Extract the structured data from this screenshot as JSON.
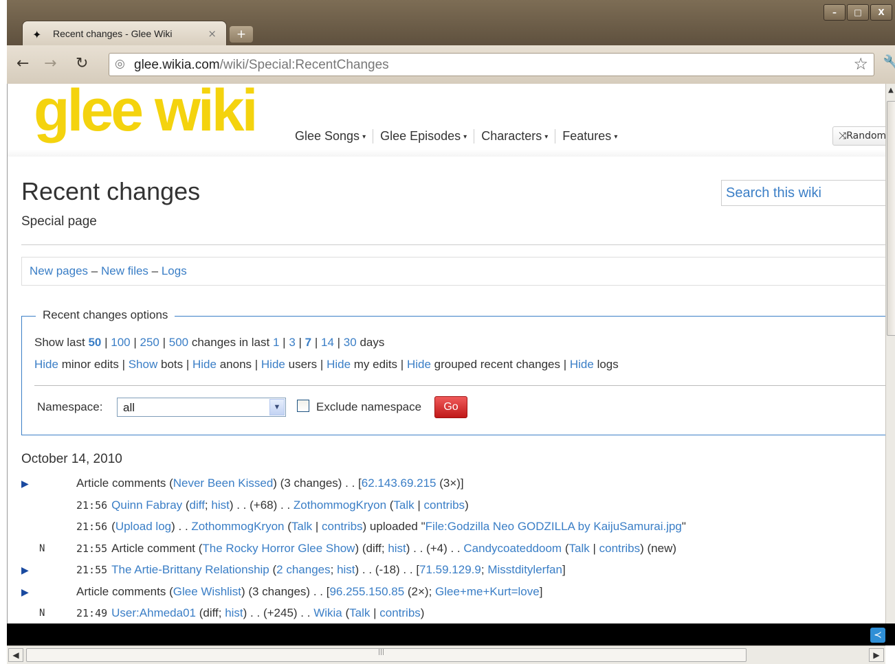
{
  "browser": {
    "tab_title": "Recent changes - Glee Wiki",
    "tab_close": "×",
    "new_tab": "+",
    "url_domain": "glee.wikia.com",
    "url_path": "/wiki/Special:RecentChanges",
    "window_controls": [
      "–",
      "□",
      "X"
    ]
  },
  "site": {
    "logo": "glee wiki",
    "nav": [
      {
        "label": "Glee Songs"
      },
      {
        "label": "Glee Episodes"
      },
      {
        "label": "Characters"
      },
      {
        "label": "Features"
      }
    ],
    "random_button": "Random"
  },
  "header": {
    "title": "Recent changes",
    "subtitle": "Special page",
    "search_placeholder": "Search this wiki"
  },
  "quicklinks": {
    "new_pages": "New pages",
    "sep1": " – ",
    "new_files": "New files",
    "sep2": " – ",
    "logs": "Logs"
  },
  "options": {
    "legend": "Recent changes options",
    "show_last": "Show last ",
    "limits": [
      "50",
      "100",
      "250",
      "500"
    ],
    "changes_in_last": " changes in last ",
    "days_options": [
      "1",
      "3",
      "7",
      "14",
      "30"
    ],
    "days": " days",
    "toggles": [
      {
        "action": "Hide",
        "label": "minor edits"
      },
      {
        "action": "Show",
        "label": "bots"
      },
      {
        "action": "Hide",
        "label": "anons"
      },
      {
        "action": "Hide",
        "label": "users"
      },
      {
        "action": "Hide",
        "label": "my edits"
      },
      {
        "action": "Hide",
        "label": "grouped recent changes"
      },
      {
        "action": "Hide",
        "label": "logs"
      }
    ],
    "namespace_label": "Namespace:",
    "namespace_value": "all",
    "exclude_label": "Exclude namespace",
    "go": "Go"
  },
  "changes": {
    "date": "October 14, 2010",
    "rows": [
      {
        "marker": "▶",
        "flag": "",
        "time": "",
        "parts": [
          {
            "t": "Article comments ("
          },
          {
            "t": "Never Been Kissed",
            "link": true
          },
          {
            "t": ") (3 changes) . . ["
          },
          {
            "t": "62.143.69.215",
            "link": true
          },
          {
            "t": " (3×)]"
          }
        ]
      },
      {
        "marker": "",
        "flag": "",
        "time": "21:56",
        "parts": [
          {
            "t": "Quinn Fabray",
            "link": true
          },
          {
            "t": " ("
          },
          {
            "t": "diff",
            "link": true
          },
          {
            "t": "; "
          },
          {
            "t": "hist",
            "link": true
          },
          {
            "t": ") . . (+68) . . "
          },
          {
            "t": "ZothommogKryon",
            "link": true
          },
          {
            "t": " ("
          },
          {
            "t": "Talk",
            "link": true
          },
          {
            "t": " | "
          },
          {
            "t": "contribs",
            "link": true
          },
          {
            "t": ")"
          }
        ]
      },
      {
        "marker": "",
        "flag": "",
        "time": "21:56",
        "parts": [
          {
            "t": "("
          },
          {
            "t": "Upload log",
            "link": true
          },
          {
            "t": ") . . "
          },
          {
            "t": "ZothommogKryon",
            "link": true
          },
          {
            "t": " ("
          },
          {
            "t": "Talk",
            "link": true
          },
          {
            "t": " | "
          },
          {
            "t": "contribs",
            "link": true
          },
          {
            "t": ") uploaded \""
          },
          {
            "t": "File:Godzilla Neo GODZILLA by KaijuSamurai.jpg",
            "link": true
          },
          {
            "t": "\""
          }
        ]
      },
      {
        "marker": "",
        "flag": "N",
        "time": "21:55",
        "parts": [
          {
            "t": "Article comment ("
          },
          {
            "t": "The Rocky Horror Glee Show",
            "link": true
          },
          {
            "t": ") (diff; "
          },
          {
            "t": "hist",
            "link": true
          },
          {
            "t": ") . . (+4) . . "
          },
          {
            "t": "Candycoateddoom",
            "link": true
          },
          {
            "t": " ("
          },
          {
            "t": "Talk",
            "link": true
          },
          {
            "t": " | "
          },
          {
            "t": "contribs",
            "link": true
          },
          {
            "t": ") (new)"
          }
        ]
      },
      {
        "marker": "▶",
        "flag": "",
        "time": "21:55",
        "parts": [
          {
            "t": "The Artie-Brittany Relationship",
            "link": true
          },
          {
            "t": " ("
          },
          {
            "t": "2 changes",
            "link": true
          },
          {
            "t": "; "
          },
          {
            "t": "hist",
            "link": true
          },
          {
            "t": ") . . (-18) . . ["
          },
          {
            "t": "71.59.129.9",
            "link": true
          },
          {
            "t": "; "
          },
          {
            "t": "Misstditylerfan",
            "link": true
          },
          {
            "t": "]"
          }
        ]
      },
      {
        "marker": "▶",
        "flag": "",
        "time": "",
        "parts": [
          {
            "t": "Article comments ("
          },
          {
            "t": "Glee Wishlist",
            "link": true
          },
          {
            "t": ") (3 changes) . . ["
          },
          {
            "t": "96.255.150.85",
            "link": true
          },
          {
            "t": " (2×); "
          },
          {
            "t": "Glee+me+Kurt=love",
            "link": true
          },
          {
            "t": "]"
          }
        ]
      },
      {
        "marker": "",
        "flag": "N",
        "time": "21:49",
        "parts": [
          {
            "t": "User:Ahmeda01",
            "link": true
          },
          {
            "t": " (diff; "
          },
          {
            "t": "hist",
            "link": true
          },
          {
            "t": ") . . (+245) . . "
          },
          {
            "t": "Wikia",
            "link": true
          },
          {
            "t": " ("
          },
          {
            "t": "Talk",
            "link": true
          },
          {
            "t": " | "
          },
          {
            "t": "contribs",
            "link": true
          },
          {
            "t": ")"
          }
        ]
      }
    ]
  }
}
